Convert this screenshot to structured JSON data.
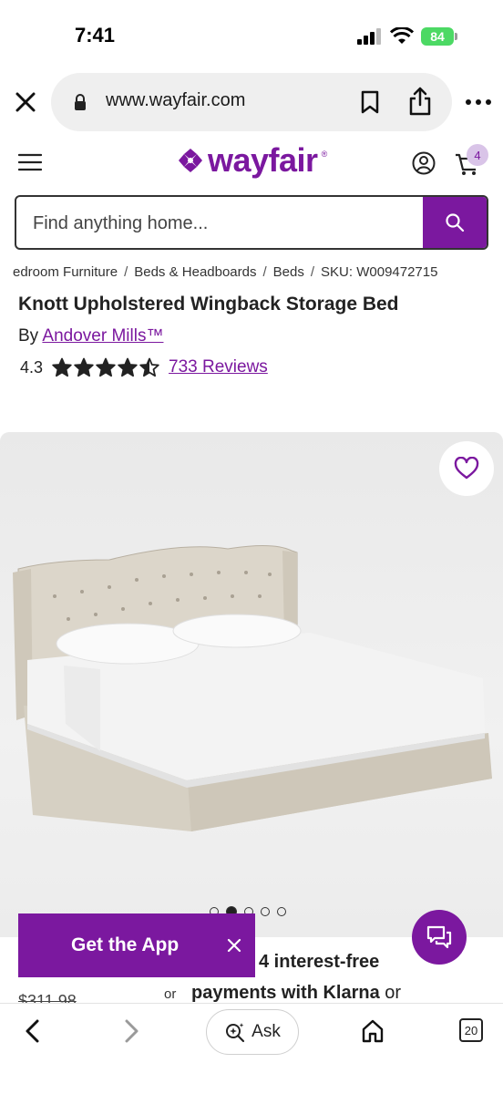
{
  "status_bar": {
    "time": "7:41",
    "battery": "84"
  },
  "browser": {
    "url": "www.wayfair.com"
  },
  "header": {
    "logo_text": "wayfair",
    "cart_count": "4"
  },
  "search": {
    "placeholder": "Find anything home..."
  },
  "breadcrumb": [
    "edroom Furniture",
    "Beds & Headboards",
    "Beds",
    "SKU: W009472715"
  ],
  "product": {
    "title": "Knott Upholstered Wingback Storage Bed",
    "by_label": "By",
    "brand": "Andover Mills™",
    "rating": "4.3",
    "stars": 4.3,
    "reviews": "733 Reviews"
  },
  "carousel": {
    "count": 5,
    "active": 1
  },
  "pricing": {
    "price_strike": "$311.98",
    "klarna_line1": "4 interest-free",
    "or_text": "or",
    "klarna_line2_pre": "payments with",
    "klarna_brand": "Klarna",
    "klarna_line2_post": "or"
  },
  "app_banner": {
    "label": "Get the App"
  },
  "toolbar": {
    "ask_label": "Ask",
    "tabs_count": "20"
  },
  "colors": {
    "brand": "#7b189f",
    "battery": "#4cd964"
  },
  "icons": [
    "close-icon",
    "lock-icon",
    "bookmark-icon",
    "share-icon",
    "more-icon",
    "hamburger-icon",
    "account-icon",
    "cart-icon",
    "search-icon",
    "heart-icon",
    "chat-icon",
    "back-icon",
    "forward-icon",
    "sparkle-search-icon",
    "home-icon",
    "tabs-icon"
  ]
}
